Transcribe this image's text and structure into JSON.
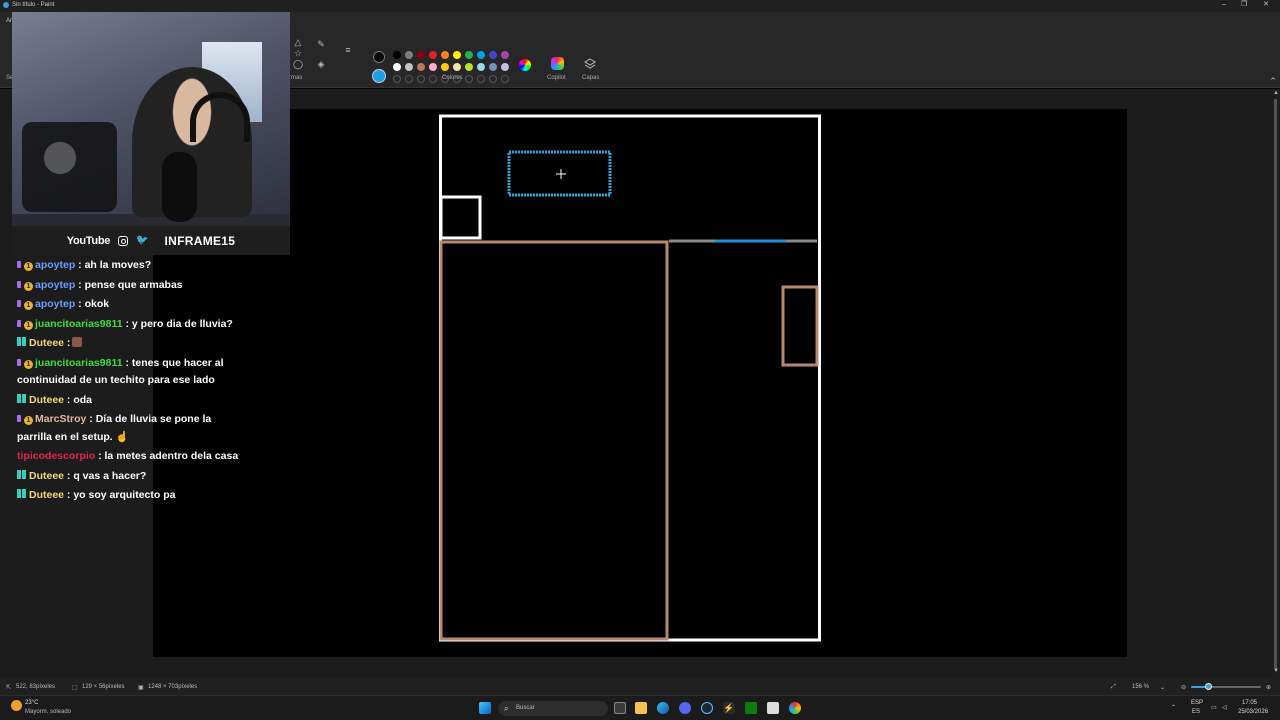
{
  "window": {
    "title": "Sin título - Paint"
  },
  "ribbon": {
    "menu_first": "Ar",
    "selection_label_partial": "Se",
    "shapes_label_partial": "rmas",
    "colors_label": "Colores",
    "copilot_label": "Copilot",
    "layers_label": "Capas",
    "palette_row1": [
      "#000000",
      "#7f7f7f",
      "#880015",
      "#ed1c24",
      "#ff7f27",
      "#fff200",
      "#22b14c",
      "#00a2e8",
      "#3f48cc",
      "#a349a4"
    ],
    "palette_row2": [
      "#ffffff",
      "#c3c3c3",
      "#b97a57",
      "#ffaec9",
      "#ffc90e",
      "#efe4b0",
      "#b5e61d",
      "#99d9ea",
      "#7092be",
      "#c8bfe7"
    ],
    "primary_color": "#000000",
    "secondary_color": "#18a0e8"
  },
  "overlay": {
    "social_youtube": "YouTube",
    "social_handle": "INFRAME15"
  },
  "chat": [
    {
      "user": "apoytep",
      "color": "#6c9cff",
      "badges": [
        "mini",
        "badge"
      ],
      "text": ": ah la moves?"
    },
    {
      "user": "apoytep",
      "color": "#6c9cff",
      "badges": [
        "mini",
        "badge"
      ],
      "text": ": pense que armabas"
    },
    {
      "user": "apoytep",
      "color": "#6c9cff",
      "badges": [
        "mini",
        "badge"
      ],
      "text": ": okok"
    },
    {
      "user": "juancitoarias9811",
      "color": "#3ddc3d",
      "badges": [
        "mini",
        "badge"
      ],
      "text": ": y pero dia de lluvia?"
    },
    {
      "user": "Duteee",
      "color": "#f0d97a",
      "badges": [
        "grid"
      ],
      "text": ":",
      "emote": true
    },
    {
      "user": "juancitoarias9811",
      "color": "#3ddc3d",
      "badges": [
        "mini",
        "badge"
      ],
      "text": ": tenes que hacer al continuidad de un techito para ese lado"
    },
    {
      "user": "Duteee",
      "color": "#f0d97a",
      "badges": [
        "grid"
      ],
      "text": ": oda"
    },
    {
      "user": "MarcStroy",
      "color": "#e6b3a0",
      "badges": [
        "mini",
        "badge"
      ],
      "text": ": Día de lluvia se pone la parrilla en el setup. ☝"
    },
    {
      "user": "tipicodescorpio",
      "color": "#e0244c",
      "badges": [],
      "text": ": la metes adentro dela casa"
    },
    {
      "user": "Duteee",
      "color": "#f0d97a",
      "badges": [
        "grid"
      ],
      "text": ": q vas a hacer?"
    },
    {
      "user": "Duteee",
      "color": "#f0d97a",
      "badges": [
        "grid"
      ],
      "text": ": yo soy arquitecto pa"
    }
  ],
  "status": {
    "cursor_pos": "522, 83píxeles",
    "selection_size": "129 × 56píxeles",
    "canvas_size": "1248 × 703píxeles",
    "zoom": "156 %",
    "zoom_fraction": 0.24
  },
  "taskbar": {
    "weather_temp": "23°C",
    "weather_desc": "Mayorm. soleado",
    "search_placeholder": "Buscar",
    "lang_top": "ESP",
    "lang_bottom": "ES",
    "time": "17:05",
    "date": "25/03/2026"
  },
  "colors": {
    "wall": "#ffffff",
    "room": "#b88872",
    "selection": "#29a8e0",
    "door_gray": "#8a8a8a",
    "door_blue": "#1e90d8"
  }
}
